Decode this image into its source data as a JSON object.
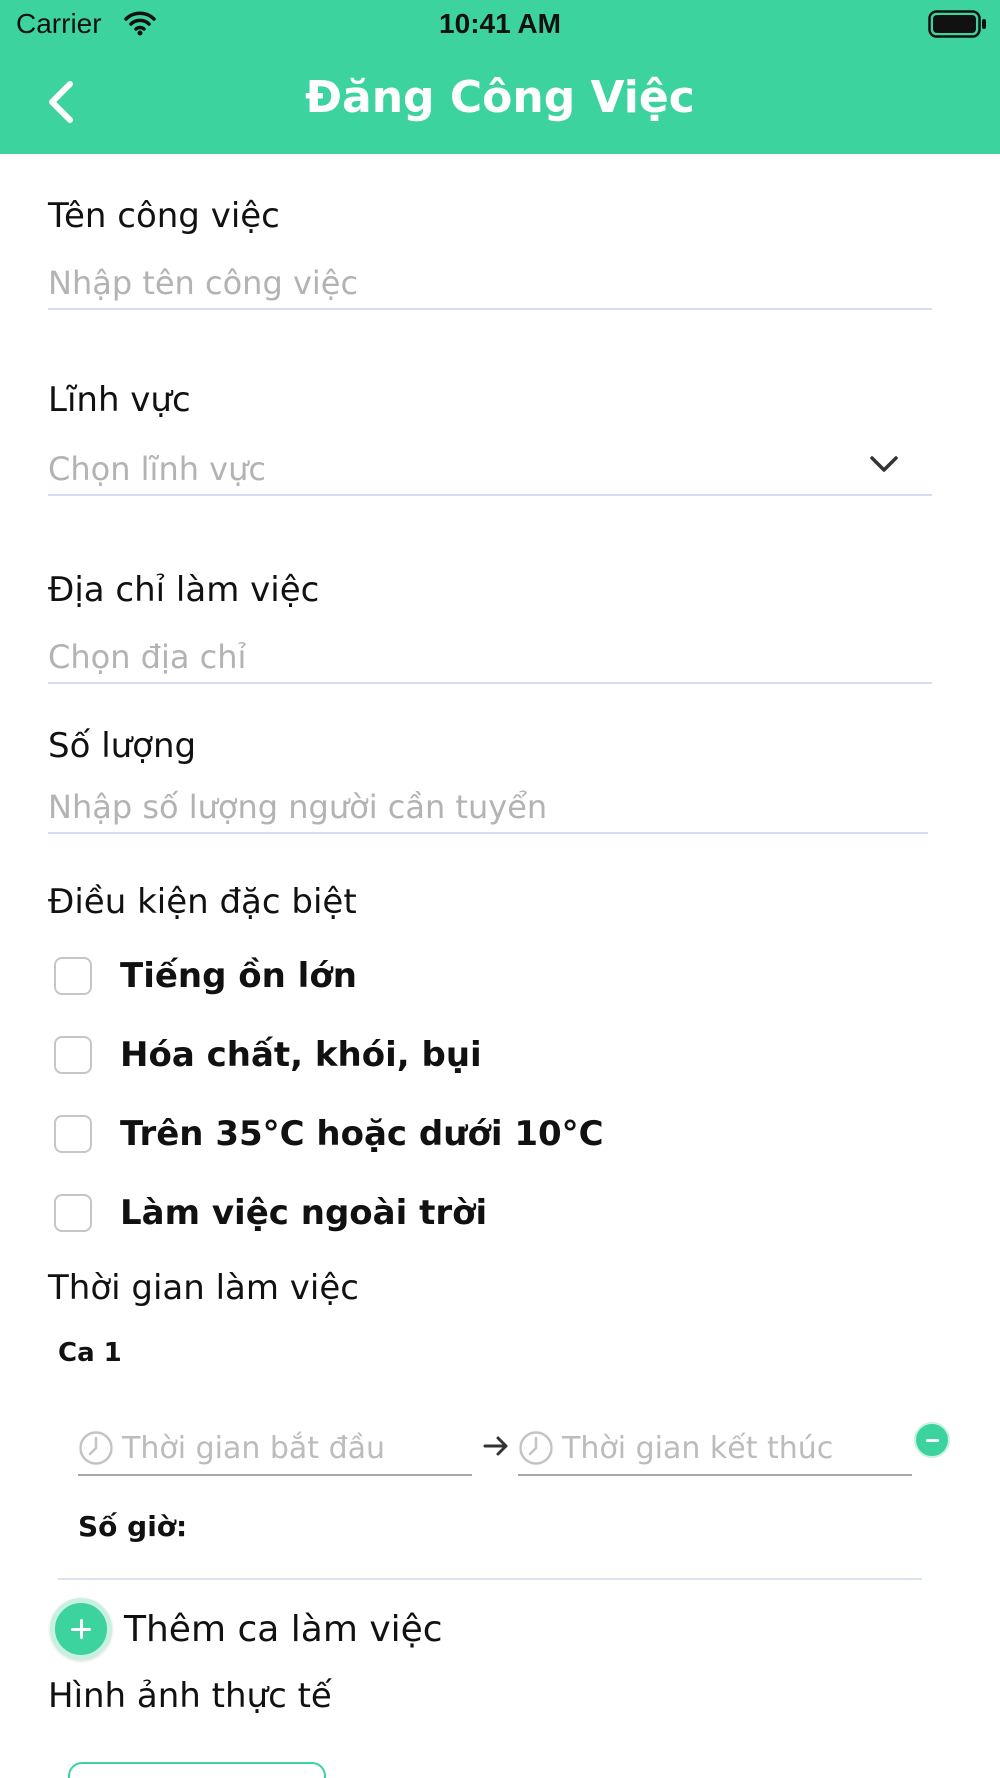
{
  "status_bar": {
    "carrier": "Carrier",
    "time": "10:41 AM"
  },
  "header": {
    "title": "Đăng Công Việc",
    "accent_color": "#3dd39e"
  },
  "form": {
    "job_name": {
      "label": "Tên công việc",
      "placeholder": "Nhập tên công việc"
    },
    "field": {
      "label": "Lĩnh vực",
      "placeholder": "Chọn lĩnh vực"
    },
    "address": {
      "label": "Địa chỉ làm việc",
      "placeholder": "Chọn địa chỉ"
    },
    "quantity": {
      "label": "Số lượng",
      "placeholder": "Nhập số lượng người cần tuyển"
    },
    "special_conditions": {
      "label": "Điều kiện đặc biệt",
      "options": [
        {
          "label": "Tiếng ồn lớn",
          "checked": false
        },
        {
          "label": "Hóa chất, khói, bụi",
          "checked": false
        },
        {
          "label": "Trên 35°C hoặc dưới 10°C",
          "checked": false
        },
        {
          "label": "Làm việc ngoài trời",
          "checked": false
        }
      ]
    },
    "work_time": {
      "label": "Thời gian làm việc",
      "shifts": [
        {
          "title": "Ca 1",
          "start_placeholder": "Thời gian bắt đầu",
          "end_placeholder": "Thời gian kết thúc",
          "hours_label": "Số giờ:"
        }
      ],
      "add_shift_label": "Thêm ca làm việc"
    },
    "photos": {
      "label": "Hình ảnh thực tế"
    }
  }
}
